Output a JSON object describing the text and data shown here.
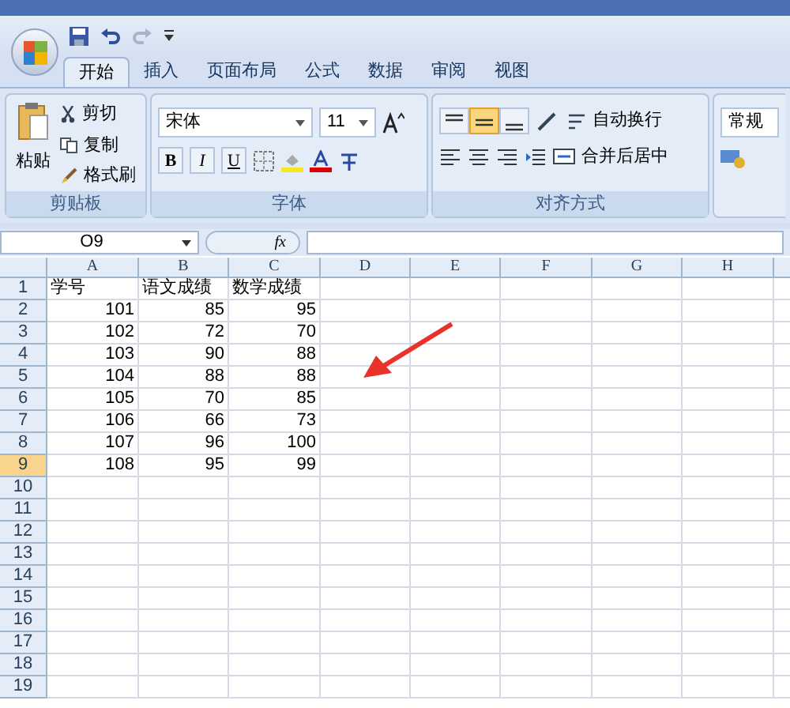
{
  "tabs": [
    {
      "label": "开始",
      "selected": true
    },
    {
      "label": "插入",
      "selected": false
    },
    {
      "label": "页面布局",
      "selected": false
    },
    {
      "label": "公式",
      "selected": false
    },
    {
      "label": "数据",
      "selected": false
    },
    {
      "label": "审阅",
      "selected": false
    },
    {
      "label": "视图",
      "selected": false
    }
  ],
  "clipboard": {
    "paste": "粘贴",
    "cut": "剪切",
    "copy": "复制",
    "format_painter": "格式刷",
    "label": "剪贴板"
  },
  "font": {
    "name": "宋体",
    "size": "11",
    "label": "字体",
    "bold": "B",
    "italic": "I",
    "underline": "U"
  },
  "alignment": {
    "vertical": [
      {
        "selected": false
      },
      {
        "selected": true
      },
      {
        "selected": false
      }
    ],
    "wrap": "自动换行",
    "merge": "合并后居中",
    "label": "对齐方式"
  },
  "number": {
    "format": "常规"
  },
  "name_box": "O9",
  "fx": "fx",
  "columns": [
    "A",
    "B",
    "C",
    "D",
    "E",
    "F",
    "G",
    "H"
  ],
  "rows": [
    {
      "label": "1",
      "selected": false,
      "cells": [
        "学号",
        "语文成绩",
        "数学成绩"
      ]
    },
    {
      "label": "2",
      "selected": false,
      "cells": [
        "101",
        "85",
        "95"
      ]
    },
    {
      "label": "3",
      "selected": false,
      "cells": [
        "102",
        "72",
        "70"
      ]
    },
    {
      "label": "4",
      "selected": false,
      "cells": [
        "103",
        "90",
        "88"
      ]
    },
    {
      "label": "5",
      "selected": false,
      "cells": [
        "104",
        "88",
        "88"
      ]
    },
    {
      "label": "6",
      "selected": false,
      "cells": [
        "105",
        "70",
        "85"
      ]
    },
    {
      "label": "7",
      "selected": false,
      "cells": [
        "106",
        "66",
        "73"
      ]
    },
    {
      "label": "8",
      "selected": false,
      "cells": [
        "107",
        "96",
        "100"
      ]
    },
    {
      "label": "9",
      "selected": true,
      "cells": [
        "108",
        "95",
        "99"
      ]
    },
    {
      "label": "10",
      "selected": false,
      "cells": []
    },
    {
      "label": "11",
      "selected": false,
      "cells": []
    },
    {
      "label": "12",
      "selected": false,
      "cells": []
    },
    {
      "label": "13",
      "selected": false,
      "cells": []
    },
    {
      "label": "14",
      "selected": false,
      "cells": []
    },
    {
      "label": "15",
      "selected": false,
      "cells": []
    },
    {
      "label": "16",
      "selected": false,
      "cells": []
    },
    {
      "label": "17",
      "selected": false,
      "cells": []
    },
    {
      "label": "18",
      "selected": false,
      "cells": []
    },
    {
      "label": "19",
      "selected": false,
      "cells": []
    }
  ]
}
